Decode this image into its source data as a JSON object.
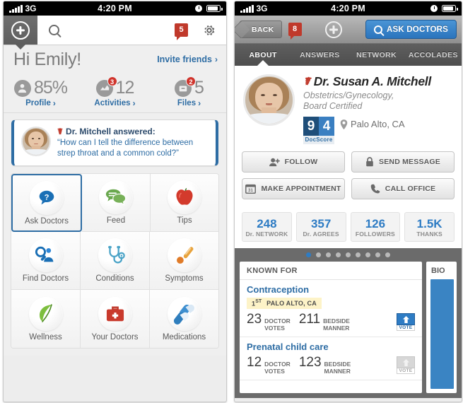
{
  "status_bar": {
    "network": "3G",
    "time": "4:20 PM"
  },
  "left_screen": {
    "nav": {
      "plus_icon": "plus-circle-icon",
      "search_icon": "search-icon",
      "notification_count": "5",
      "settings_icon": "gear-icon"
    },
    "greeting": {
      "title": "Hi Emily!",
      "invite_label": "Invite friends",
      "chevron": "›"
    },
    "stats": [
      {
        "value": "85%",
        "label": "Profile",
        "icon": "person-icon",
        "badge": ""
      },
      {
        "value": "12",
        "label": "Activities",
        "icon": "activity-icon",
        "badge": "3"
      },
      {
        "value": "5",
        "label": "Files",
        "icon": "files-icon",
        "badge": "2"
      }
    ],
    "answer_card": {
      "caduceus_icon": "caduceus-icon",
      "title": "Dr. Mitchell answered:",
      "question": "“How can I tell the difference between strep throat and a common cold?”"
    },
    "tiles": [
      {
        "label": "Ask Doctors",
        "icon": "question-bubble-icon",
        "selected": true
      },
      {
        "label": "Feed",
        "icon": "chat-bubbles-icon",
        "selected": false
      },
      {
        "label": "Tips",
        "icon": "apple-icon",
        "selected": false
      },
      {
        "label": "Find Doctors",
        "icon": "doctor-search-icon",
        "selected": false
      },
      {
        "label": "Conditions",
        "icon": "stethoscope-icon",
        "selected": false
      },
      {
        "label": "Symptoms",
        "icon": "thermometer-icon",
        "selected": false
      },
      {
        "label": "Wellness",
        "icon": "leaf-icon",
        "selected": false
      },
      {
        "label": "Your Doctors",
        "icon": "medical-bag-icon",
        "selected": false
      },
      {
        "label": "Medications",
        "icon": "pills-icon",
        "selected": false
      }
    ]
  },
  "right_screen": {
    "nav": {
      "back_label": "BACK",
      "notification_count": "8",
      "plus_icon": "plus-circle-icon",
      "ask_label": "ASK DOCTORS",
      "ask_icon": "search-icon"
    },
    "tabs": [
      {
        "label": "ABOUT",
        "active": true
      },
      {
        "label": "ANSWERS",
        "active": false
      },
      {
        "label": "NETWORK",
        "active": false
      },
      {
        "label": "ACCOLADES",
        "active": false
      }
    ],
    "profile": {
      "caduceus_icon": "caduceus-icon",
      "name": "Dr. Susan A. Mitchell",
      "specialty": "Obstetrics/Gynecology,\nBoard Certified",
      "specialty_line1": "Obstetrics/Gynecology,",
      "specialty_line2": "Board Certified",
      "docscore": {
        "digit1": "9",
        "digit2": "4",
        "label": "DocScore"
      },
      "location": "Palo Alto, CA",
      "location_icon": "map-pin-icon"
    },
    "actions": [
      {
        "label": "FOLLOW",
        "icon": "add-person-icon"
      },
      {
        "label": "SEND MESSAGE",
        "icon": "lock-icon"
      },
      {
        "label": "MAKE APPOINTMENT",
        "icon": "calendar-icon"
      },
      {
        "label": "CALL OFFICE",
        "icon": "phone-icon"
      }
    ],
    "stats": [
      {
        "value": "248",
        "label": "Dr. NETWORK"
      },
      {
        "value": "357",
        "label": "Dr. AGREES"
      },
      {
        "value": "126",
        "label": "FOLLOWERS"
      },
      {
        "value": "1.5K",
        "label": "THANKS"
      }
    ],
    "carousel": {
      "dots": 9,
      "active_dot": 0
    },
    "known_for": {
      "header": "KNOWN FOR",
      "items": [
        {
          "name": "Contraception",
          "rank": "1",
          "rank_suffix": "ST",
          "region": "PALO ALTO, CA",
          "doctor_votes": "23",
          "doctor_votes_label_1": "DOCTOR",
          "doctor_votes_label_2": "VOTES",
          "bedside": "211",
          "bedside_label_1": "BEDSIDE",
          "bedside_label_2": "MANNER",
          "vote_label": "VOTE",
          "vote_active": true
        },
        {
          "name": "Prenatal child care",
          "rank": "",
          "rank_suffix": "",
          "region": "",
          "doctor_votes": "12",
          "doctor_votes_label_1": "DOCTOR",
          "doctor_votes_label_2": "VOTES",
          "bedside": "123",
          "bedside_label_1": "BEDSIDE",
          "bedside_label_2": "MANNER",
          "vote_label": "VOTE",
          "vote_active": false
        }
      ]
    },
    "bio_card": {
      "header": "BIO"
    }
  },
  "colors": {
    "brand_blue": "#2e6da4",
    "accent_blue": "#2e7cc4",
    "badge_red": "#c0392b",
    "panel_gray": "#efefef",
    "dark_nav": "#4e4e4e"
  }
}
